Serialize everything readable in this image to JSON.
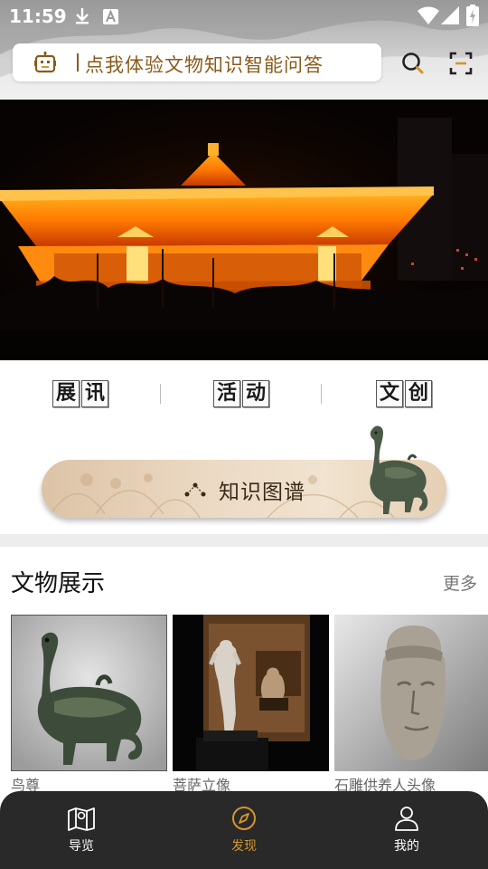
{
  "status_bar": {
    "time": "11:59"
  },
  "search": {
    "placeholder": "点我体验文物知识智能问答"
  },
  "quick_links": [
    {
      "chars": [
        "展",
        "讯"
      ]
    },
    {
      "chars": [
        "活",
        "动"
      ]
    },
    {
      "chars": [
        "文",
        "创"
      ]
    }
  ],
  "knowledge_graph": {
    "label": "知识图谱"
  },
  "relics_section": {
    "title": "文物展示",
    "more": "更多",
    "items": [
      {
        "name": "鸟尊"
      },
      {
        "name": "菩萨立像"
      },
      {
        "name": "石雕供养人头像"
      }
    ]
  },
  "bottom_nav": [
    {
      "label": "导览",
      "icon": "map-icon",
      "active": false
    },
    {
      "label": "发现",
      "icon": "compass-icon",
      "active": true
    },
    {
      "label": "我的",
      "icon": "user-icon",
      "active": false
    }
  ],
  "colors": {
    "accent": "#d4952c",
    "brand_brown": "#8a5a1a",
    "nav_bg": "#292929"
  }
}
